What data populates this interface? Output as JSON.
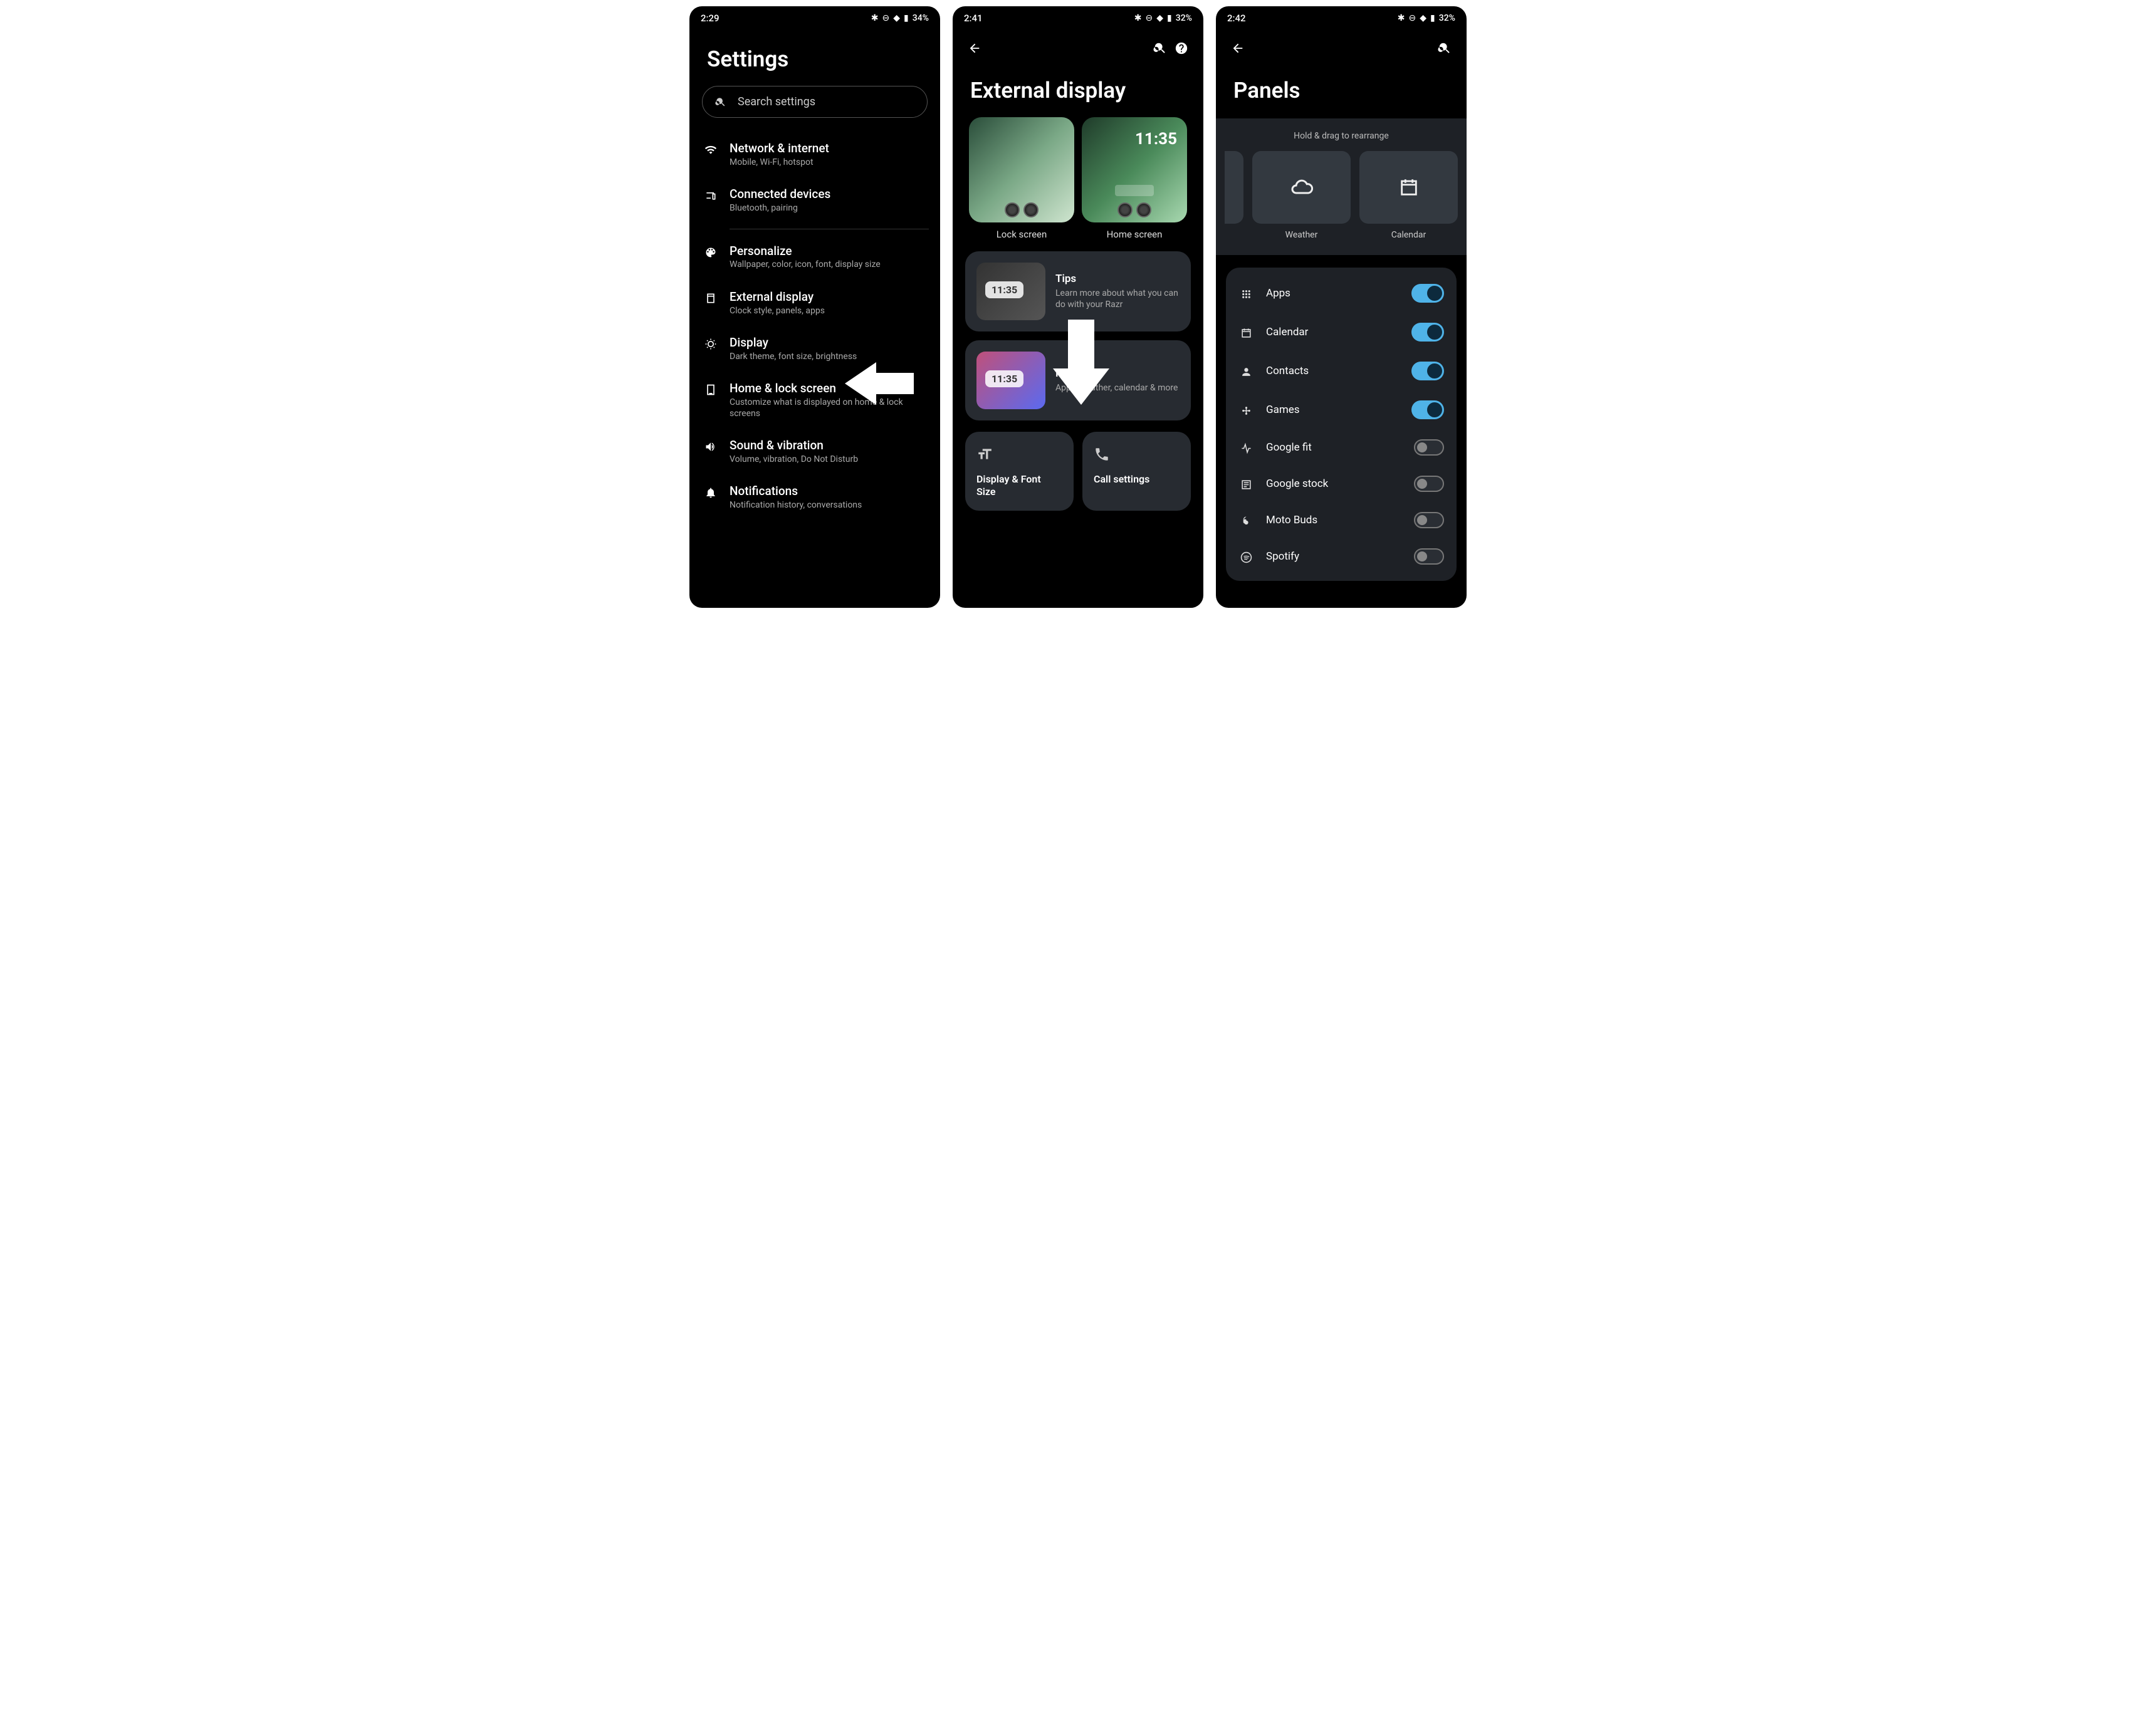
{
  "screens": {
    "s1": {
      "time": "2:29",
      "battery": "34%",
      "title": "Settings",
      "search_placeholder": "Search settings",
      "items": [
        {
          "icon": "wifi",
          "title": "Network & internet",
          "sub": "Mobile, Wi-Fi, hotspot"
        },
        {
          "icon": "devices",
          "title": "Connected devices",
          "sub": "Bluetooth, pairing"
        },
        {
          "icon": "palette",
          "title": "Personalize",
          "sub": "Wallpaper, color, icon, font, display size"
        },
        {
          "icon": "ext",
          "title": "External display",
          "sub": "Clock style, panels, apps"
        },
        {
          "icon": "sun",
          "title": "Display",
          "sub": "Dark theme, font size, brightness"
        },
        {
          "icon": "lock",
          "title": "Home & lock screen",
          "sub": "Customize what is displayed on home & lock screens"
        },
        {
          "icon": "volume",
          "title": "Sound & vibration",
          "sub": "Volume, vibration, Do Not Disturb"
        },
        {
          "icon": "bell",
          "title": "Notifications",
          "sub": "Notification history, conversations"
        }
      ]
    },
    "s2": {
      "time": "2:41",
      "battery": "32%",
      "title": "External display",
      "tiles": [
        {
          "label": "Lock screen"
        },
        {
          "label": "Home screen",
          "clock": "11:35"
        }
      ],
      "cards": [
        {
          "title": "Tips",
          "sub": "Learn more about what you can do with your Razr",
          "thumb": "photo",
          "mini_clock": "11:35"
        },
        {
          "title": "Panels",
          "sub": "Apps, weather, calendar & more",
          "thumb": "panels",
          "mini_clock": "11:35"
        }
      ],
      "mini": [
        {
          "icon": "font",
          "label": "Display & Font Size"
        },
        {
          "icon": "phone",
          "label": "Call settings"
        }
      ]
    },
    "s3": {
      "time": "2:42",
      "battery": "32%",
      "title": "Panels",
      "hint": "Hold & drag to rearrange",
      "rearrange": [
        {
          "icon": "cloud",
          "label": "Weather"
        },
        {
          "icon": "calendar",
          "label": "Calendar"
        }
      ],
      "toggles": [
        {
          "icon": "apps",
          "label": "Apps",
          "on": true
        },
        {
          "icon": "calendar",
          "label": "Calendar",
          "on": true
        },
        {
          "icon": "person",
          "label": "Contacts",
          "on": true
        },
        {
          "icon": "games",
          "label": "Games",
          "on": true
        },
        {
          "icon": "fit",
          "label": "Google fit",
          "on": false
        },
        {
          "icon": "stock",
          "label": "Google stock",
          "on": false
        },
        {
          "icon": "buds",
          "label": "Moto Buds",
          "on": false
        },
        {
          "icon": "spotify",
          "label": "Spotify",
          "on": false
        }
      ]
    }
  },
  "status_icons": "✱ ⊖ ▾🔋"
}
